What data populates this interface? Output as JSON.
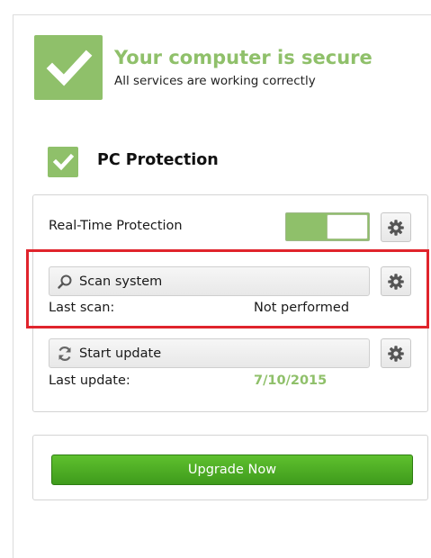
{
  "status": {
    "title": "Your computer is secure",
    "subtitle": "All services are working correctly",
    "icon": "checkmark-icon",
    "color": "#8fc06a"
  },
  "pc_protection": {
    "title": "PC Protection",
    "icon": "checkmark-icon"
  },
  "realtime": {
    "label": "Real-Time Protection",
    "enabled": true,
    "settings_icon": "gear-icon"
  },
  "scan": {
    "button_label": "Scan system",
    "button_icon": "magnifier-icon",
    "last_label": "Last scan:",
    "last_value": "Not performed",
    "settings_icon": "gear-icon"
  },
  "update": {
    "button_label": "Start update",
    "button_icon": "refresh-icon",
    "last_label": "Last update:",
    "last_value": "7/10/2015",
    "settings_icon": "gear-icon"
  },
  "upgrade": {
    "button_label": "Upgrade Now",
    "color": "#4fae24"
  },
  "highlight_color": "#e0242c"
}
